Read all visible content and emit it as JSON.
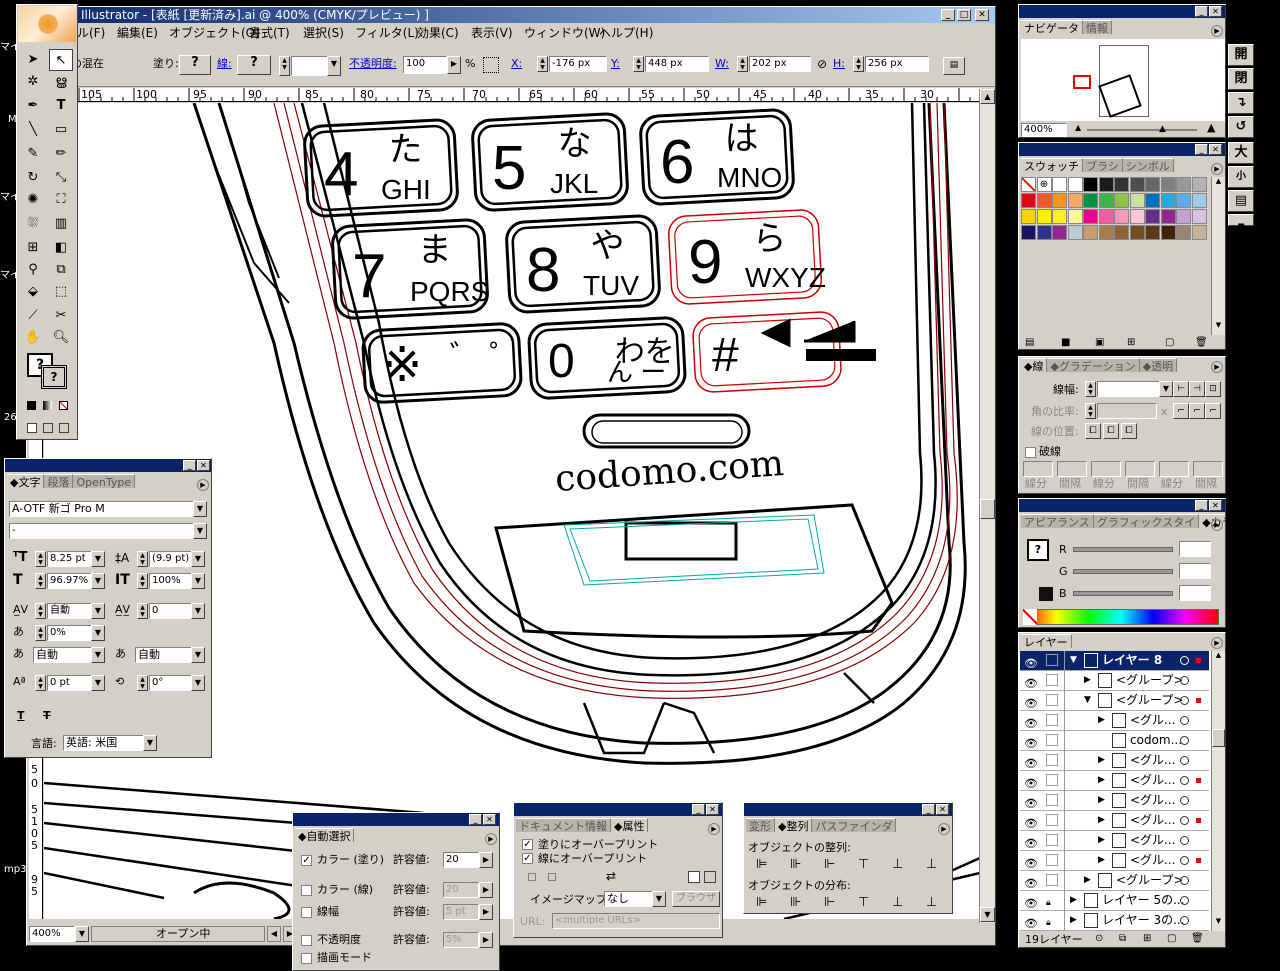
{
  "window": {
    "title": "Illustrator - [表紙 [更新済み].ai @ 400% (CMYK/プレビュー) ]",
    "status_zoom": "400%",
    "status_text": "オープン中"
  },
  "menu": [
    "ル(F)",
    "編集(E)",
    "オブジェクト(O)",
    "書式(T)",
    "選択(S)",
    "フィルタ(L)",
    "効果(C)",
    "表示(V)",
    "ウィンドウ(W)",
    "ヘルプ(H)"
  ],
  "control_bar": {
    "label": "クトの混在",
    "fill_label": "塗り:",
    "fill_value": "?",
    "stroke_label": "線:",
    "stroke_value": "?",
    "opacity_label": "不透明度:",
    "opacity_value": "100",
    "percent": "%",
    "x_label": "X:",
    "x_value": "-176 px",
    "y_label": "Y:",
    "y_value": "448 px",
    "w_label": "W:",
    "w_value": "202 px",
    "h_label": "H:",
    "h_value": "256 px"
  },
  "ruler_numbers": [
    "105",
    "100",
    "95",
    "90",
    "85",
    "80",
    "75",
    "70",
    "65",
    "60",
    "55",
    "50",
    "45",
    "40",
    "35",
    "30"
  ],
  "left_ruler_numbers": [
    "5",
    "0",
    "5",
    "1",
    "0",
    "5",
    "9",
    "5"
  ],
  "desktop_labels": [
    "マイ",
    "M",
    "マイ",
    "マイ",
    "26",
    "mp3"
  ],
  "phone": {
    "keys": [
      {
        "num": "4",
        "kana": "た",
        "letters": "GHI"
      },
      {
        "num": "5",
        "kana": "な",
        "letters": "JKL"
      },
      {
        "num": "6",
        "kana": "は",
        "letters": "MNO"
      },
      {
        "num": "7",
        "kana": "ま",
        "letters": "PQRS"
      },
      {
        "num": "8",
        "kana": "や",
        "letters": "TUV"
      },
      {
        "num": "9",
        "kana": "ら",
        "letters": "WXYZ"
      },
      {
        "num": "※",
        "kana": "゛ ゜",
        "letters": ""
      },
      {
        "num": "0",
        "kana": "わを",
        "letters": "ん ー"
      },
      {
        "num": "#",
        "kana": "",
        "letters": ""
      }
    ],
    "brand": "codomo.com"
  },
  "char_panel": {
    "tabs": [
      "文字",
      "段落",
      "OpenType"
    ],
    "font": "A-OTF 新ゴ Pro M",
    "style": "-",
    "size": "8.25 pt",
    "leading": "(9.9 pt)",
    "vscale": "96.97%",
    "hscale": "100%",
    "kerning": "自動",
    "tracking": "0",
    "tsume": "0%",
    "aki_left": "自動",
    "aki_right": "自動",
    "baseline": "0 pt",
    "rotation": "0°",
    "lang_label": "言語:",
    "lang_value": "英語: 米国"
  },
  "auto_select": {
    "title": "自動選択",
    "rows": [
      {
        "label": "カラー (塗り)",
        "checked": "✓",
        "tol_label": "許容値:",
        "value": "20"
      },
      {
        "label": "カラー (線)",
        "checked": "",
        "tol_label": "許容値:",
        "value": "20"
      },
      {
        "label": "線幅",
        "checked": "",
        "tol_label": "許容値:",
        "value": "5 pt"
      },
      {
        "label": "不透明度",
        "checked": "",
        "tol_label": "許容値:",
        "value": "5%"
      },
      {
        "label": "描画モード",
        "checked": "",
        "tol_label": "",
        "value": ""
      }
    ]
  },
  "attr_panel": {
    "tabs": [
      "ドキュメント情報",
      "属性"
    ],
    "overprint_fill": "塗りにオーバープリント",
    "overprint_stroke": "線にオーバープリント",
    "imagemap_label": "イメージマップ:",
    "imagemap_value": "なし",
    "browser_btn": "ブラウザ",
    "url_label": "URL:",
    "url_value": "<multiple URLs>"
  },
  "align_panel": {
    "tabs": [
      "変形",
      "整列",
      "パスファインダ"
    ],
    "align_label": "オブジェクトの整列:",
    "distribute_label": "オブジェクトの分布:"
  },
  "navigator": {
    "tabs": [
      "ナビゲータ",
      "情報"
    ],
    "zoom": "400%"
  },
  "swatches": {
    "tabs": [
      "スウォッチ",
      "ブラシ",
      "シンボル"
    ],
    "colors": [
      "#ffffff",
      "#000000",
      "#ffffff",
      "#ffffff",
      "#000000",
      "#1a1a1a",
      "#333333",
      "#4d4d4d",
      "#666666",
      "#808080",
      "#999999",
      "#b3b3b3",
      "#e30613",
      "#f05a28",
      "#f7941d",
      "#f7a864",
      "#009245",
      "#39b54a",
      "#8cc63f",
      "#c6e0a0",
      "#0071bc",
      "#29abe2",
      "#5dade2",
      "#9ecbe8",
      "#ffd200",
      "#fff200",
      "#fcee21",
      "#fff799",
      "#ec008c",
      "#ef60a3",
      "#f49ac1",
      "#f9c6dd",
      "#662d91",
      "#92278f",
      "#c6a0d3",
      "#d6c4e0",
      "#1b1464",
      "#2e3192",
      "#93278f",
      "#bdccd4",
      "#c69c6d",
      "#a67c52",
      "#8c6239",
      "#754c24",
      "#603813",
      "#42210b",
      "#998675",
      "#c7b299"
    ]
  },
  "stroke_panel": {
    "tabs": [
      "線",
      "グラデーション",
      "透明"
    ],
    "weight_label": "線幅:",
    "miter_label": "角の比率:",
    "align_label": "線の位置:",
    "dashed_label": "破線",
    "dash_labels": [
      "線分",
      "間隔",
      "線分",
      "間隔",
      "線分",
      "間隔"
    ]
  },
  "color_panel": {
    "tabs": [
      "アピアランス",
      "グラフィックスタイ",
      "カラー"
    ],
    "r_label": "R",
    "g_label": "G",
    "b_label": "B"
  },
  "layers": {
    "tab": "レイヤー",
    "rows": [
      {
        "name": "レイヤー 8",
        "indent": 0
      },
      {
        "name": "<グループ>",
        "indent": 1
      },
      {
        "name": "<グループ>",
        "indent": 1
      },
      {
        "name": "<グル...",
        "indent": 2
      },
      {
        "name": "codom...",
        "indent": 2
      },
      {
        "name": "<グル...",
        "indent": 2
      },
      {
        "name": "<グル...",
        "indent": 2
      },
      {
        "name": "<グル...",
        "indent": 2
      },
      {
        "name": "<グル...",
        "indent": 2
      },
      {
        "name": "<グル...",
        "indent": 2
      },
      {
        "name": "<グル...",
        "indent": 2
      },
      {
        "name": "<グループ>",
        "indent": 1
      },
      {
        "name": "レイヤー 5の...",
        "indent": 0
      },
      {
        "name": "レイヤー 3の...",
        "indent": 0
      }
    ],
    "count": "19レイヤー"
  },
  "side_buttons": [
    "開",
    "閉",
    "",
    "",
    "大",
    "小",
    ""
  ]
}
